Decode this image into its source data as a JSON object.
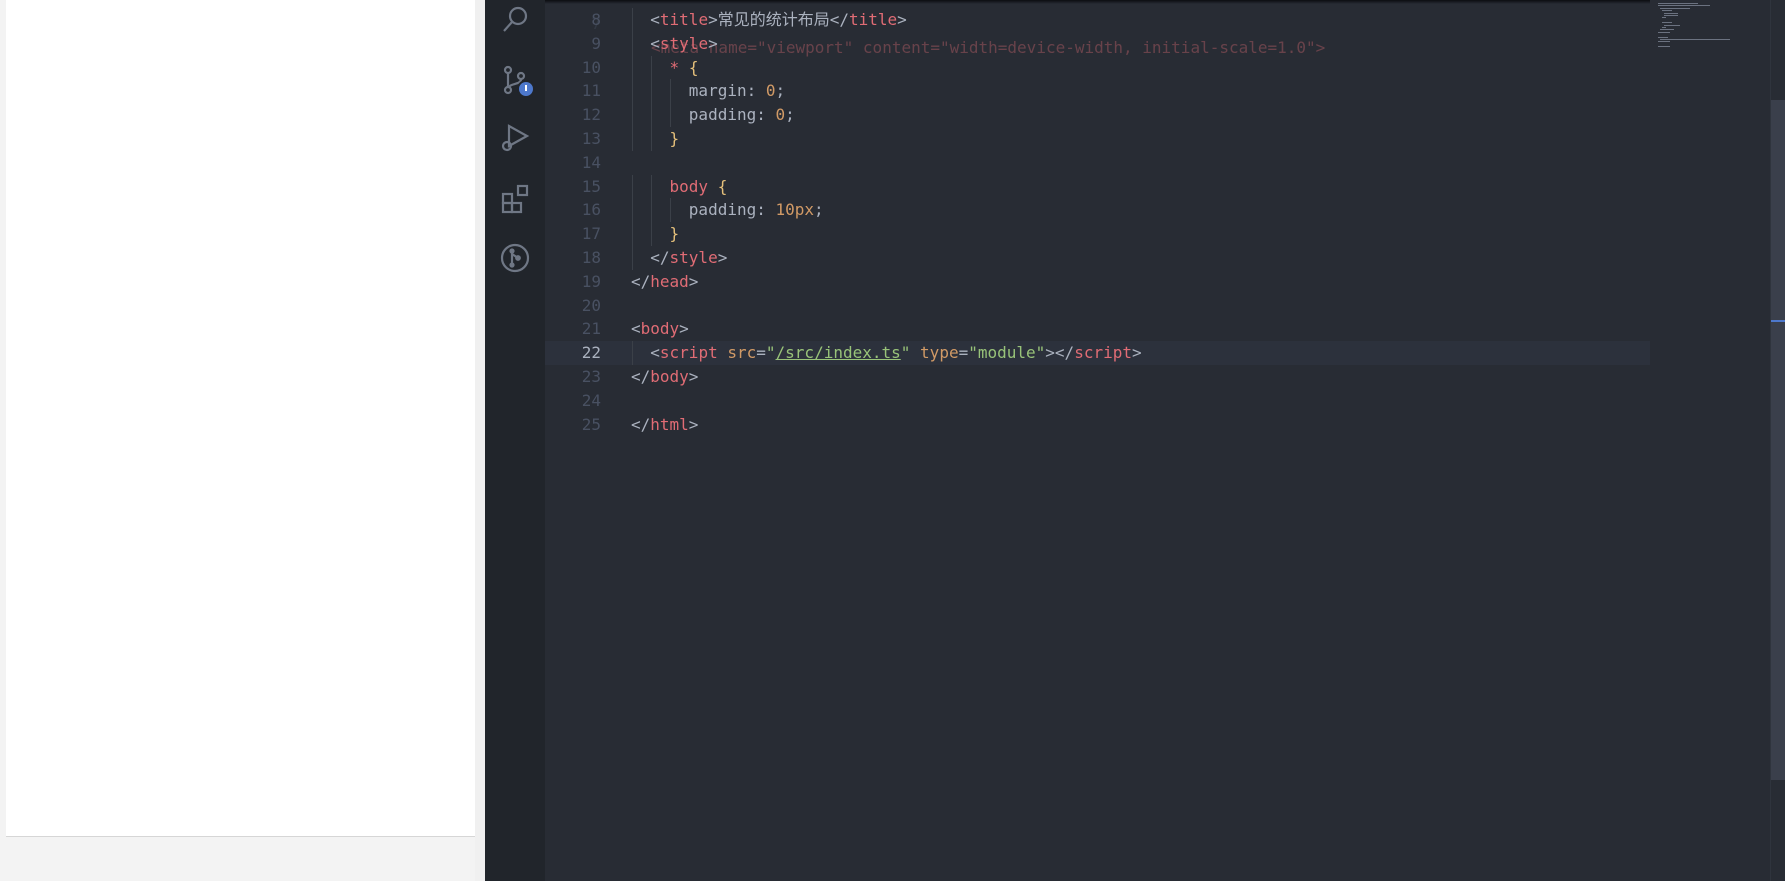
{
  "editor": {
    "partial_line_7": "<meta name=\"viewport\" content=\"width=device-width, initial-scale=1.0\">",
    "lines": [
      {
        "n": "8",
        "html": "  <span class='tok-punc'>&lt;</span><span class='tok-tag'>title</span><span class='tok-punc'>&gt;</span>常见的统计布局<span class='tok-punc'>&lt;/</span><span class='tok-tag'>title</span><span class='tok-punc'>&gt;</span>"
      },
      {
        "n": "9",
        "html": "  <span class='tok-punc'>&lt;</span><span class='tok-tag'>style</span><span class='tok-punc'>&gt;</span>"
      },
      {
        "n": "10",
        "html": "    <span class='tok-sel'>*</span> <span class='tok-brace'>{</span>"
      },
      {
        "n": "11",
        "html": "      <span class='tok-prop'>margin</span>: <span class='tok-num'>0</span>;"
      },
      {
        "n": "12",
        "html": "      <span class='tok-prop'>padding</span>: <span class='tok-num'>0</span>;"
      },
      {
        "n": "13",
        "html": "    <span class='tok-brace'>}</span>"
      },
      {
        "n": "14",
        "html": ""
      },
      {
        "n": "15",
        "html": "    <span class='tok-sel'>body</span> <span class='tok-brace'>{</span>"
      },
      {
        "n": "16",
        "html": "      <span class='tok-prop'>padding</span>: <span class='tok-num'>10px</span>;"
      },
      {
        "n": "17",
        "html": "    <span class='tok-brace'>}</span>"
      },
      {
        "n": "18",
        "html": "  <span class='tok-punc'>&lt;/</span><span class='tok-tag'>style</span><span class='tok-punc'>&gt;</span>"
      },
      {
        "n": "19",
        "html": "<span class='tok-punc'>&lt;/</span><span class='tok-tag'>head</span><span class='tok-punc'>&gt;</span>"
      },
      {
        "n": "20",
        "html": ""
      },
      {
        "n": "21",
        "html": "<span class='tok-punc'>&lt;</span><span class='tok-tag'>body</span><span class='tok-punc'>&gt;</span>"
      },
      {
        "n": "22",
        "html": "  <span class='tok-punc'>&lt;</span><span class='tok-tag'>script</span> <span class='tok-attr'>src</span>=<span class='tok-str'>\"</span><span class='tok-link'>/src/index.ts</span><span class='tok-str'>\"</span> <span class='tok-attr'>type</span>=<span class='tok-str'>\"module\"</span><span class='tok-punc'>&gt;&lt;/</span><span class='tok-tag'>script</span><span class='tok-punc'>&gt;</span>",
        "current": true
      },
      {
        "n": "23",
        "html": "<span class='tok-punc'>&lt;/</span><span class='tok-tag'>body</span><span class='tok-punc'>&gt;</span>"
      },
      {
        "n": "24",
        "html": ""
      },
      {
        "n": "25",
        "html": "<span class='tok-punc'>&lt;/</span><span class='tok-tag'>html</span><span class='tok-punc'>&gt;</span>"
      }
    ]
  },
  "activity_bar": {
    "icons": [
      "search-icon",
      "source-control-icon",
      "run-debug-icon",
      "extensions-icon",
      "git-graph-icon"
    ]
  },
  "colors": {
    "editor_bg": "#282c34",
    "activity_bg": "#21252b",
    "tag": "#e06c75",
    "string": "#98c379",
    "number": "#d19a66",
    "brace": "#e5c07b",
    "accent": "#4d78cc"
  }
}
